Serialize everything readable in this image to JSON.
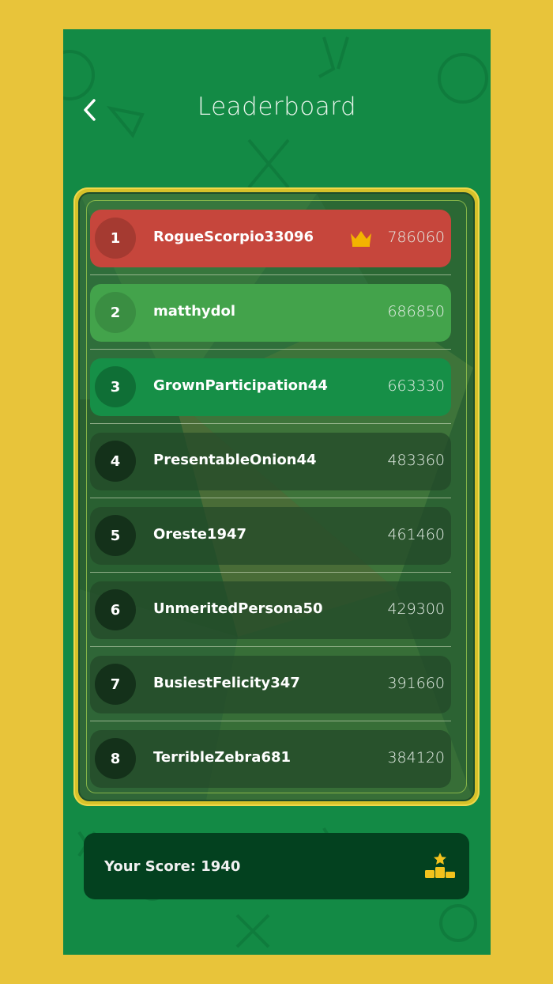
{
  "header": {
    "title": "Leaderboard"
  },
  "leaderboard": {
    "rows": [
      {
        "rank": "1",
        "name": "RogueScorpio33096",
        "score": "786060",
        "crown": true
      },
      {
        "rank": "2",
        "name": "matthydol",
        "score": "686850"
      },
      {
        "rank": "3",
        "name": "GrownParticipation44",
        "score": "663330"
      },
      {
        "rank": "4",
        "name": "PresentableOnion44",
        "score": "483360"
      },
      {
        "rank": "5",
        "name": "Oreste1947",
        "score": "461460"
      },
      {
        "rank": "6",
        "name": "UnmeritedPersona50",
        "score": "429300"
      },
      {
        "rank": "7",
        "name": "BusiestFelicity347",
        "score": "391660"
      },
      {
        "rank": "8",
        "name": "TerribleZebra681",
        "score": "384120"
      }
    ]
  },
  "footer": {
    "your_score_label": "Your Score: 1940"
  },
  "icons": {
    "back": "chevron-left-icon",
    "crown": "crown-icon",
    "podium": "podium-star-icon"
  },
  "colors": {
    "background": "#e8c43a",
    "screen": "#138a45",
    "row_gold": "#c6463c",
    "row_silver": "#43a34b",
    "row_bronze": "#168f47",
    "row_default": "#2e5a34",
    "your_score_bg": "#03411f",
    "accent": "#f0c419"
  }
}
